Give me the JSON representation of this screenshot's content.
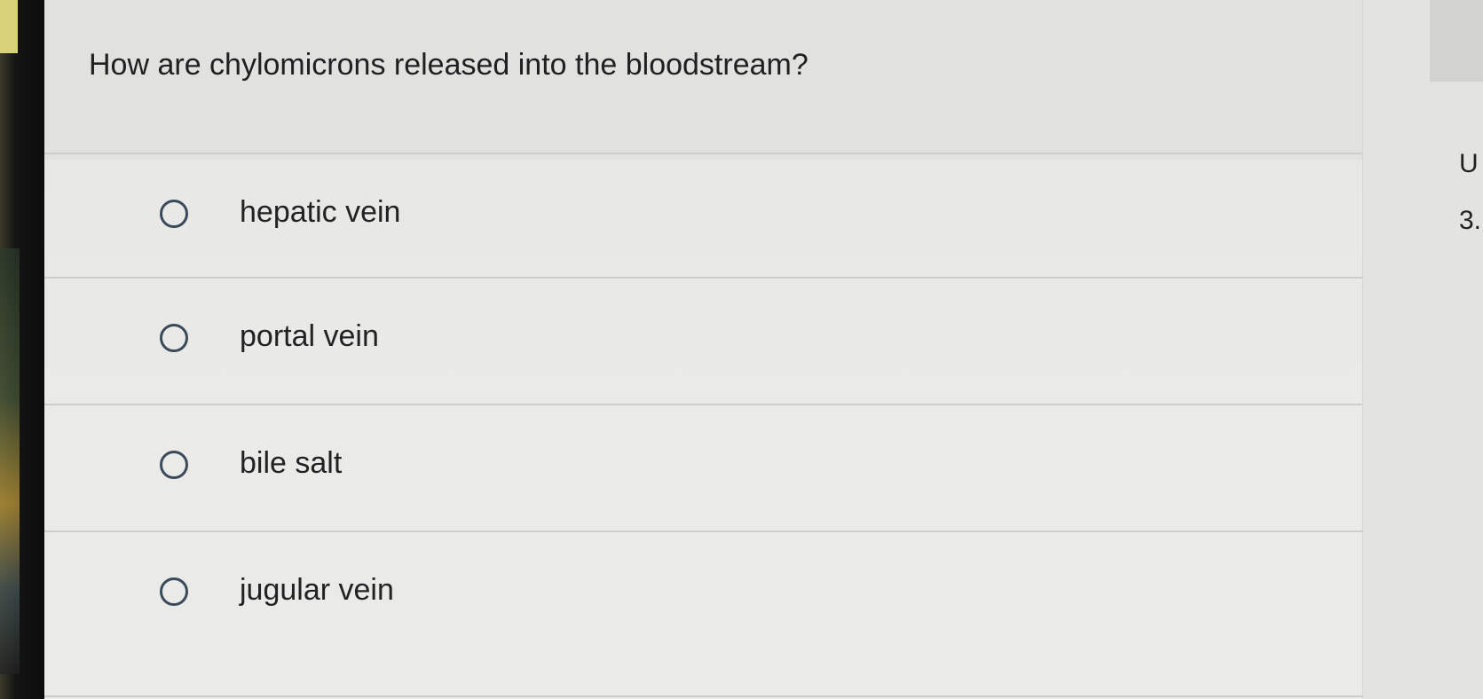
{
  "question": {
    "text": "How are chylomicrons released into the bloodstream?"
  },
  "options": [
    {
      "label": "hepatic vein",
      "selected": false
    },
    {
      "label": "portal vein",
      "selected": false
    },
    {
      "label": "bile salt",
      "selected": false
    },
    {
      "label": "jugular vein",
      "selected": false
    }
  ],
  "side_panel": {
    "letter": "U",
    "number": "3."
  },
  "colors": {
    "radio_border": "#3b4a5a",
    "text": "#222222",
    "background": "#e9e9e7"
  }
}
